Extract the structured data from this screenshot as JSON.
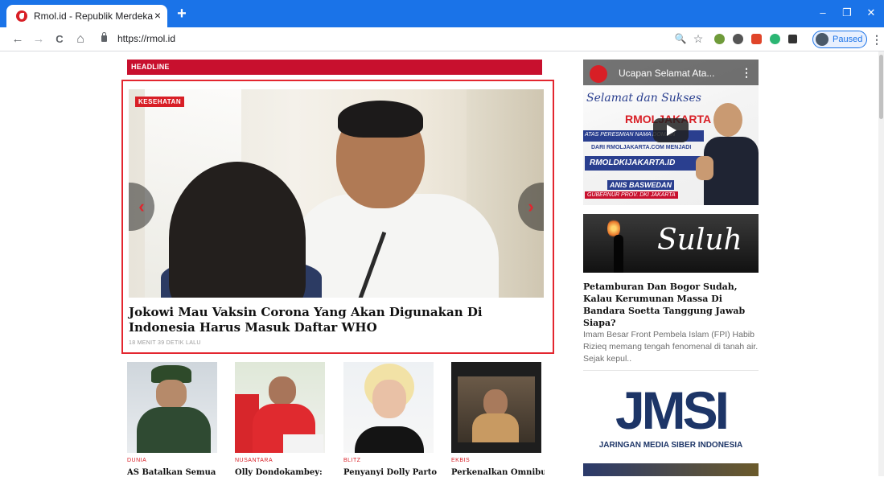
{
  "browser": {
    "tab_title": "Rmol.id - Republik Merdeka",
    "tab_close": "×",
    "new_tab": "+",
    "url": "https://rmol.id",
    "profile_status": "Paused",
    "window": {
      "minimize": "–",
      "restore": "❐",
      "close": "✕"
    },
    "nav": {
      "back": "←",
      "forward": "→",
      "reload": "C",
      "home": "⌂"
    },
    "toolbar_icons": {
      "zoom": "🔍",
      "star": "☆",
      "menu": "⋮"
    },
    "ext_colors": [
      "#6f9b3a",
      "#555555",
      "#e0452a",
      "#2bb673",
      "#333333"
    ]
  },
  "headline": {
    "label": "HEADLINE",
    "category": "KESEHATAN",
    "title": "Jokowi Mau Vaksin Corona Yang Akan Digunakan Di Indonesia Harus Masuk Daftar WHO",
    "time": "18 MENIT 39 DETIK LALU",
    "prev": "‹",
    "next": "›"
  },
  "thumbnails": [
    {
      "category": "DUNIA",
      "title": "AS Batalkan Semua"
    },
    {
      "category": "NUSANTARA",
      "title": "Olly Dondokambey:"
    },
    {
      "category": "BLITZ",
      "title": "Penyanyi Dolly Parton"
    },
    {
      "category": "EKBIS",
      "title": "Perkenalkan Omnibus"
    }
  ],
  "sidebar": {
    "video": {
      "title": "Ucapan Selamat Ata...",
      "script": "Selamat dan Sukses",
      "rmol": "RMOLJAKARTA",
      "strip": "ATAS PERESMIAN NAMA DOMAIN",
      "dari": "DARI RMOLJAKARTA.COM MENJADI",
      "domain": "RMOLDKIJAKARTA.ID",
      "anis": "ANIS BASWEDAN",
      "gubernur": "GUBERNUR PROV. DKI JAKARTA"
    },
    "suluh": {
      "text": "Suluh"
    },
    "article": {
      "title": "Petamburan Dan Bogor Sudah, Kalau Kerumunan Massa Di Bandara Soetta Tanggung Jawab Siapa?",
      "excerpt": "Imam Besar Front Pembela Islam (FPI) Habib Rizieq memang tengah fenomenal di tanah air. Sejak kepul.."
    },
    "jmsi": {
      "logo": "JMSI",
      "subtitle": "JARINGAN MEDIA SIBER INDONESIA"
    }
  }
}
